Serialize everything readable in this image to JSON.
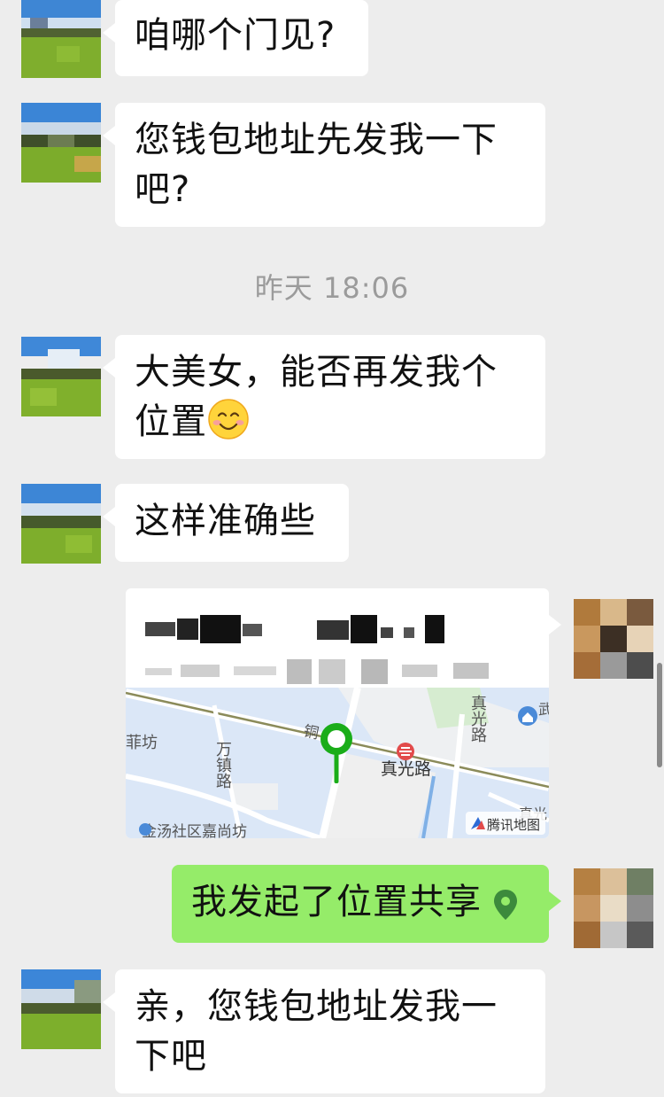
{
  "messages": {
    "m1": "咱哪个门见?",
    "m2": "您钱包地址先发我一下吧?",
    "m3_text": "大美女，能否再发我个位置",
    "m3_emoji": "smile-emoji-icon",
    "m4": "这样准确些",
    "m5": "我发起了位置共享",
    "m6": "亲，您钱包地址发我一下吧"
  },
  "timestamp": "昨天 18:06",
  "location_card": {
    "map_labels": {
      "street_main_1": "铜",
      "street_wanzhen": "万镇路",
      "street_zhenguang": "真光路",
      "street_zhenguang_v": "真光路",
      "west_label": "菲坊",
      "bottom_label": "金汤社区嘉尚坊",
      "right_edge_1": "武",
      "right_edge_2": "真光",
      "watermark": "腾讯地图"
    },
    "pin_icon": "map-pin-icon",
    "metro_icon": "metro-station-icon",
    "poi_icon": "home-poi-icon"
  },
  "colors": {
    "background": "#ededed",
    "bubble_in": "#ffffff",
    "bubble_out": "#95ec69",
    "timestamp": "#9b9b9b",
    "pin": "#1aad19",
    "map_bg": "#dbe7f7"
  },
  "icons": {
    "share_location": "location-pin-icon"
  }
}
